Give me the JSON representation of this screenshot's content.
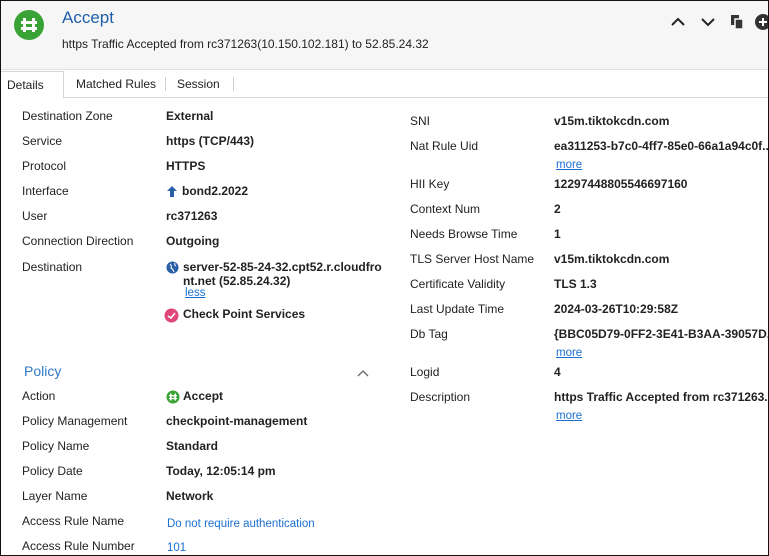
{
  "header": {
    "title": "Accept",
    "subtitle": "https Traffic Accepted from rc371263(10.150.102.181) to 52.85.24.32",
    "icons": [
      "accept-icon",
      "chevron-up-icon",
      "chevron-down-icon",
      "copy-icon",
      "more-icon"
    ]
  },
  "tabs": [
    {
      "label": "Details",
      "active": true
    },
    {
      "label": "Matched Rules",
      "active": false
    },
    {
      "label": "Session",
      "active": false
    }
  ],
  "left": {
    "rows": [
      {
        "label": "Destination Zone",
        "value": "External"
      },
      {
        "label": "Service",
        "value": "https (TCP/443)"
      },
      {
        "label": "Protocol",
        "value": "HTTPS"
      },
      {
        "label": "Interface",
        "value": "bond2.2022"
      },
      {
        "label": "User",
        "value": "rc371263"
      },
      {
        "label": "Connection Direction",
        "value": "Outgoing"
      }
    ],
    "destination": {
      "label": "Destination",
      "host_line1": "server-52-85-24-32.cpt52.r.cloudfro",
      "host_line2": "nt.net (52.85.24.32)",
      "less": "less",
      "service": "Check Point Services"
    }
  },
  "policy": {
    "title": "Policy",
    "rows": [
      {
        "label": "Action",
        "value": "Accept"
      },
      {
        "label": "Policy Management",
        "value": "checkpoint-management"
      },
      {
        "label": "Policy Name",
        "value": "Standard"
      },
      {
        "label": "Policy Date",
        "value": "Today, 12:05:14 pm"
      },
      {
        "label": "Layer Name",
        "value": "Network"
      },
      {
        "label": "Access Rule Name",
        "value": "Do not require authentication"
      },
      {
        "label": "Access Rule Number",
        "value": "101"
      }
    ]
  },
  "right": {
    "rows": [
      {
        "label": "SNI",
        "value": "v15m.tiktokcdn.com"
      },
      {
        "label": "Nat Rule Uid",
        "value": "ea311253-b7c0-4ff7-85e0-66a1a94c0f...",
        "more": "more"
      },
      {
        "label": "HII Key",
        "value": "12297448805546697160"
      },
      {
        "label": "Context Num",
        "value": "2"
      },
      {
        "label": "Needs Browse Time",
        "value": "1"
      },
      {
        "label": "TLS Server Host Name",
        "value": "v15m.tiktokcdn.com"
      },
      {
        "label": "Certificate Validity",
        "value": "TLS 1.3"
      },
      {
        "label": "Last Update Time",
        "value": "2024-03-26T10:29:58Z"
      },
      {
        "label": "Db Tag",
        "value": "{BBC05D79-0FF2-3E41-B3AA-39057D...",
        "more": "more"
      },
      {
        "label": "Logid",
        "value": "4"
      },
      {
        "label": "Description",
        "value": "https Traffic Accepted from rc371263...",
        "more": "more"
      }
    ]
  },
  "colors": {
    "accent": "#1f5fa8",
    "link": "#1a6fd1",
    "accept_green": "#3aa335",
    "section_blue": "#2f78c4"
  }
}
